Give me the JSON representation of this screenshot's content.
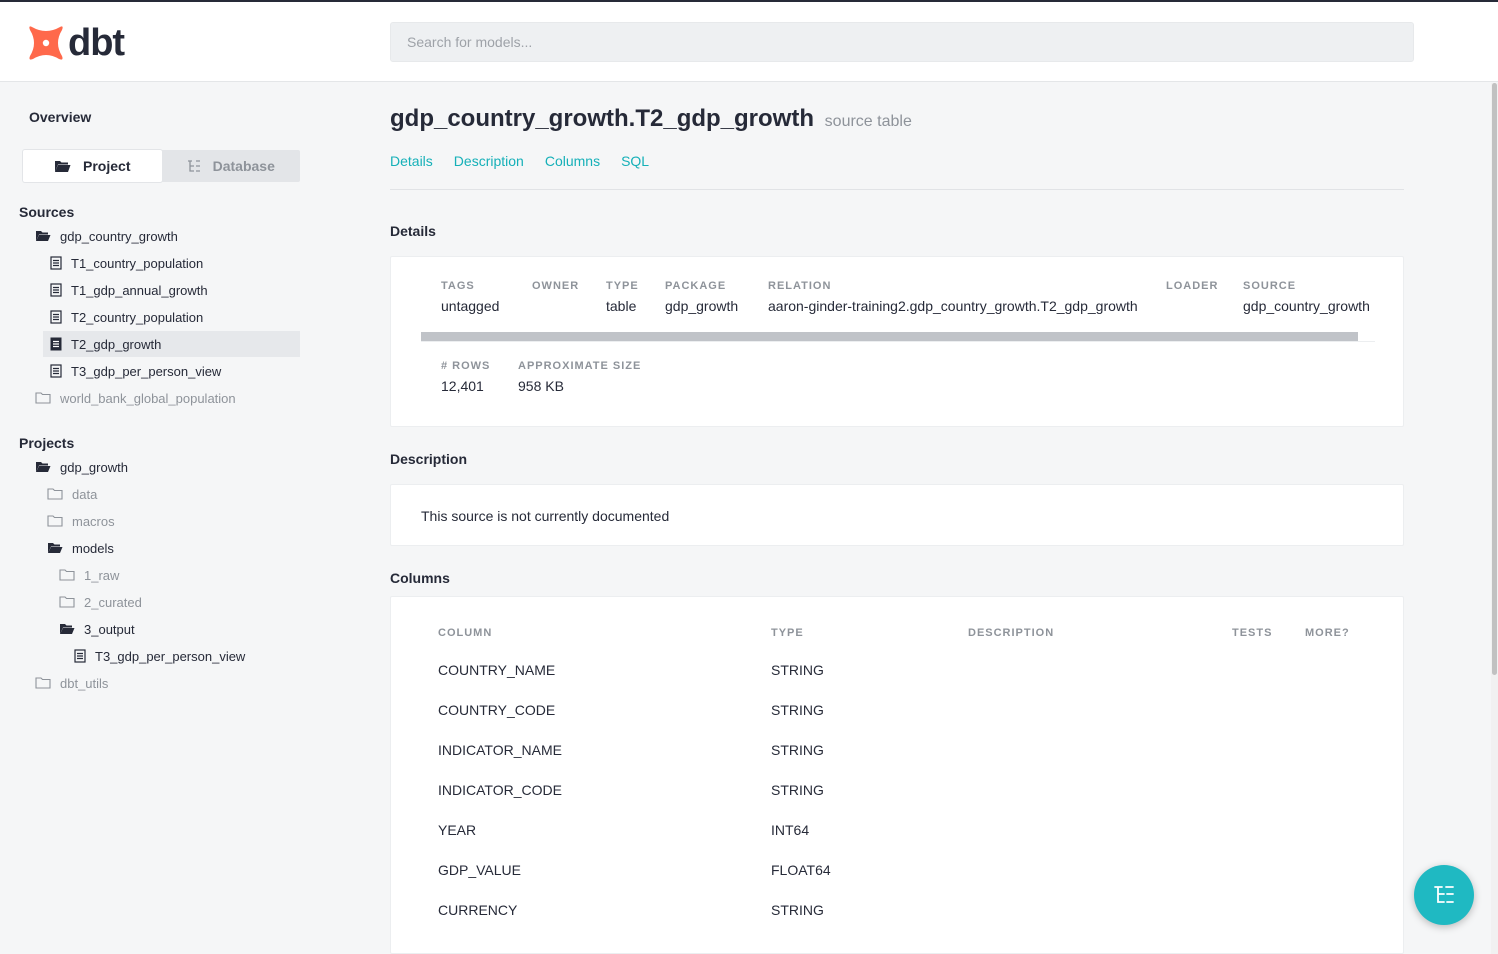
{
  "header": {
    "logo_text": "dbt",
    "search_placeholder": "Search for models..."
  },
  "sidebar": {
    "overview": "Overview",
    "switch": {
      "project": "Project",
      "database": "Database"
    },
    "sources_title": "Sources",
    "sources": [
      "gdp_country_growth",
      "T1_country_population",
      "T1_gdp_annual_growth",
      "T2_country_population",
      "T2_gdp_growth",
      "T3_gdp_per_person_view",
      "world_bank_global_population"
    ],
    "projects_title": "Projects",
    "projects": [
      "gdp_growth",
      "data",
      "macros",
      "models",
      "1_raw",
      "2_curated",
      "3_output",
      "T3_gdp_per_person_view",
      "dbt_utils"
    ]
  },
  "main": {
    "title": "gdp_country_growth.T2_gdp_growth",
    "subtitle": "source table",
    "tabs": [
      "Details",
      "Description",
      "Columns",
      "SQL"
    ],
    "details_title": "Details",
    "details": [
      {
        "key": "TAGS",
        "value": "untagged"
      },
      {
        "key": "OWNER",
        "value": ""
      },
      {
        "key": "TYPE",
        "value": "table"
      },
      {
        "key": "PACKAGE",
        "value": "gdp_growth"
      },
      {
        "key": "RELATION",
        "value": "aaron-ginder-training2.gdp_country_growth.T2_gdp_growth"
      },
      {
        "key": "LOADER",
        "value": ""
      },
      {
        "key": "SOURCE",
        "value": "gdp_country_growth"
      }
    ],
    "stats": [
      {
        "key": "# ROWS",
        "value": "12,401"
      },
      {
        "key": "APPROXIMATE SIZE",
        "value": "958 KB"
      }
    ],
    "description_title": "Description",
    "description_text": "This source is not currently documented",
    "columns_title": "Columns",
    "columns_headers": [
      "COLUMN",
      "TYPE",
      "DESCRIPTION",
      "TESTS",
      "MORE?"
    ],
    "columns": [
      {
        "name": "COUNTRY_NAME",
        "type": "STRING"
      },
      {
        "name": "COUNTRY_CODE",
        "type": "STRING"
      },
      {
        "name": "INDICATOR_NAME",
        "type": "STRING"
      },
      {
        "name": "INDICATOR_CODE",
        "type": "STRING"
      },
      {
        "name": "YEAR",
        "type": "INT64"
      },
      {
        "name": "GDP_VALUE",
        "type": "FLOAT64"
      },
      {
        "name": "CURRENCY",
        "type": "STRING"
      }
    ]
  },
  "colors": {
    "accent": "#15b0b8",
    "logo": "#ff694b",
    "fab": "#1fb9c2"
  }
}
